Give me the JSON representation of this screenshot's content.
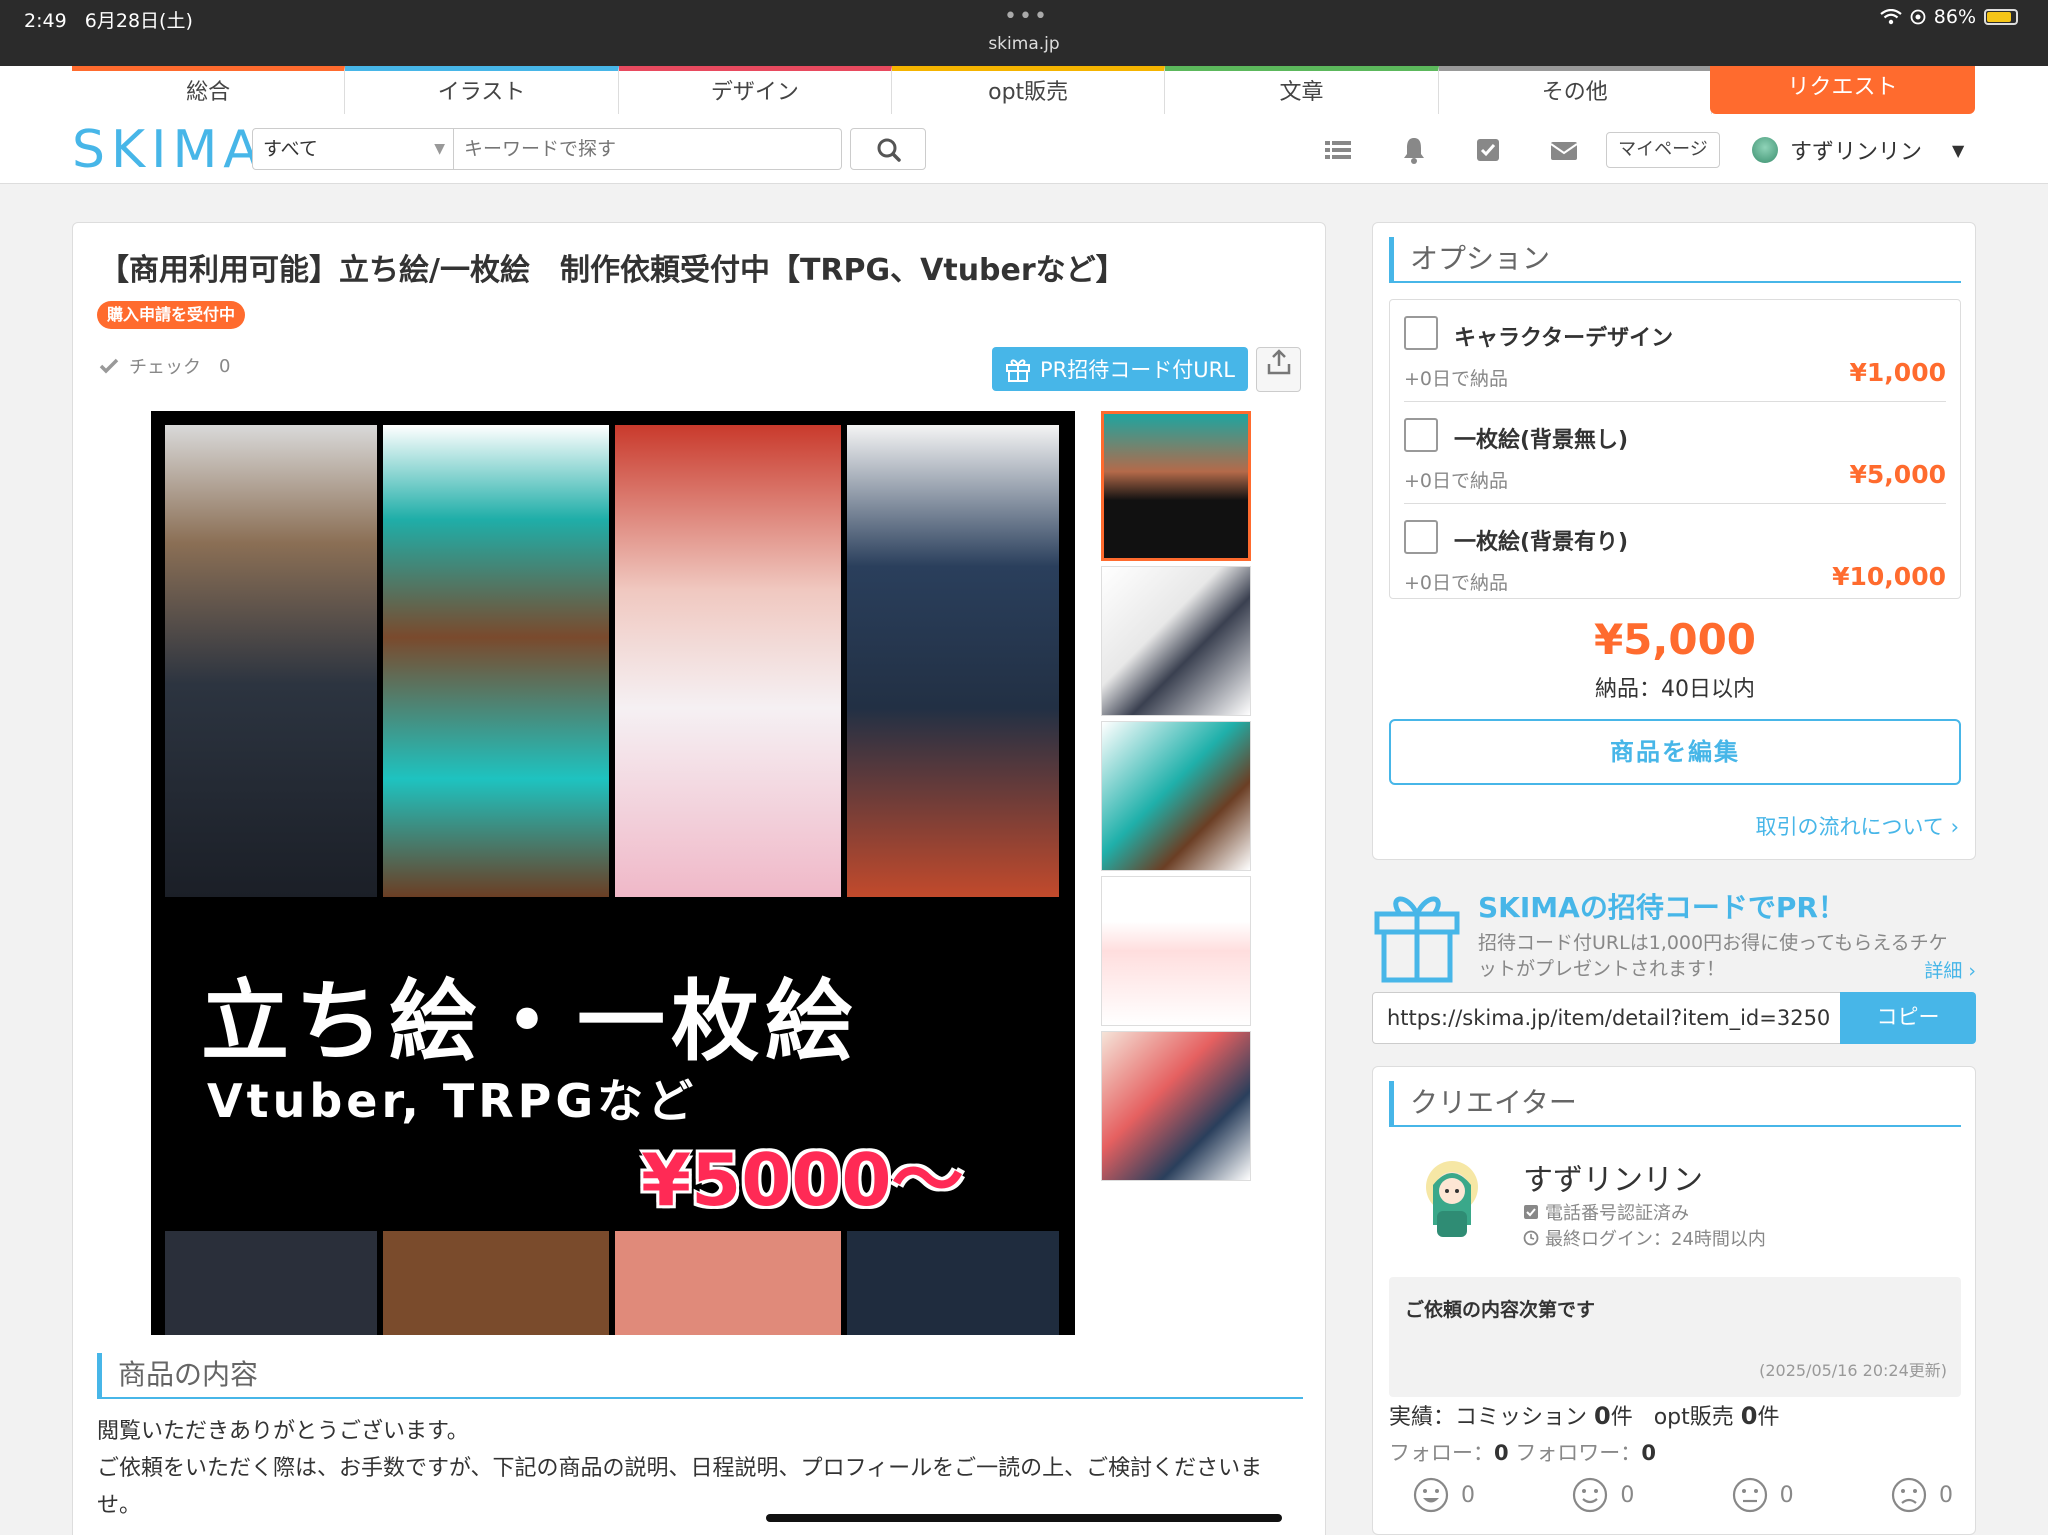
{
  "status_bar": {
    "time": "2:49",
    "date": "6月28日(土)",
    "url": "skima.jp",
    "battery": "86%"
  },
  "header": {
    "categories": [
      {
        "label": "総合",
        "color": "#ff6b2e"
      },
      {
        "label": "イラスト",
        "color": "#47b6e8"
      },
      {
        "label": "デザイン",
        "color": "#e84a5f"
      },
      {
        "label": "opt販売",
        "color": "#f5b400"
      },
      {
        "label": "文章",
        "color": "#5cb85c"
      },
      {
        "label": "その他",
        "color": "#999999"
      }
    ],
    "request_label": "リクエスト",
    "logo": "SKIMA",
    "search_scope": "すべて",
    "search_placeholder": "キーワードで探す",
    "mypage_label": "マイページ",
    "username": "すずリンリン"
  },
  "item": {
    "title": "【商用利用可能】立ち絵/一枚絵　制作依頼受付中【TRPG、Vtuberなど】",
    "status_badge": "購入申請を受付中",
    "check_label": "チェック",
    "check_count": "0",
    "pr_button": "PR招待コード付URL",
    "image_text_1": "立ち絵・一枚絵",
    "image_text_2": "Vtuber, TRPGなど",
    "image_text_3": "¥5000～",
    "section_title": "商品の内容",
    "description_lines": [
      "閲覧いただきありがとうございます。",
      "ご依頼をいただく際は、お手数ですが、下記の商品の説明、日程説明、プロフィールをご一読の上、ご検討くださいま",
      "せ。"
    ]
  },
  "options": {
    "title": "オプション",
    "items": [
      {
        "name": "キャラクターデザイン",
        "days": "+0日で納品",
        "price": "¥1,000"
      },
      {
        "name": "一枚絵(背景無し)",
        "days": "+0日で納品",
        "price": "¥5,000"
      },
      {
        "name": "一枚絵(背景有り)",
        "days": "+0日で納品",
        "price": "¥10,000"
      }
    ],
    "price": "¥5,000",
    "delivery": "納品：40日以内",
    "edit_button": "商品を編集",
    "flow_link": "取引の流れについて ›"
  },
  "invite": {
    "title": "SKIMAの招待コードでPR！",
    "desc": "招待コード付URLは1,000円お得に使ってもらえるチケットがプレゼントされます！",
    "more": "詳細 ›",
    "url": "https://skima.jp/item/detail?item_id=3250",
    "copy_label": "コピー"
  },
  "creator": {
    "title": "クリエイター",
    "name": "すずリンリン",
    "phone_verified": "電話番号認証済み",
    "last_login": "最終ログイン：24時間以内",
    "message": "ご依頼の内容次第です",
    "updated": "(2025/05/16 20:24更新)",
    "stats_label": "実績：コミッション",
    "commission_count": "0",
    "stats_unit": "件",
    "opt_label": "opt販売",
    "opt_count": "0",
    "follow_label": "フォロー：",
    "follow_count": "0",
    "follower_label": "フォロワー：",
    "follower_count": "0",
    "ratings": [
      "0",
      "0",
      "0",
      "0"
    ]
  }
}
